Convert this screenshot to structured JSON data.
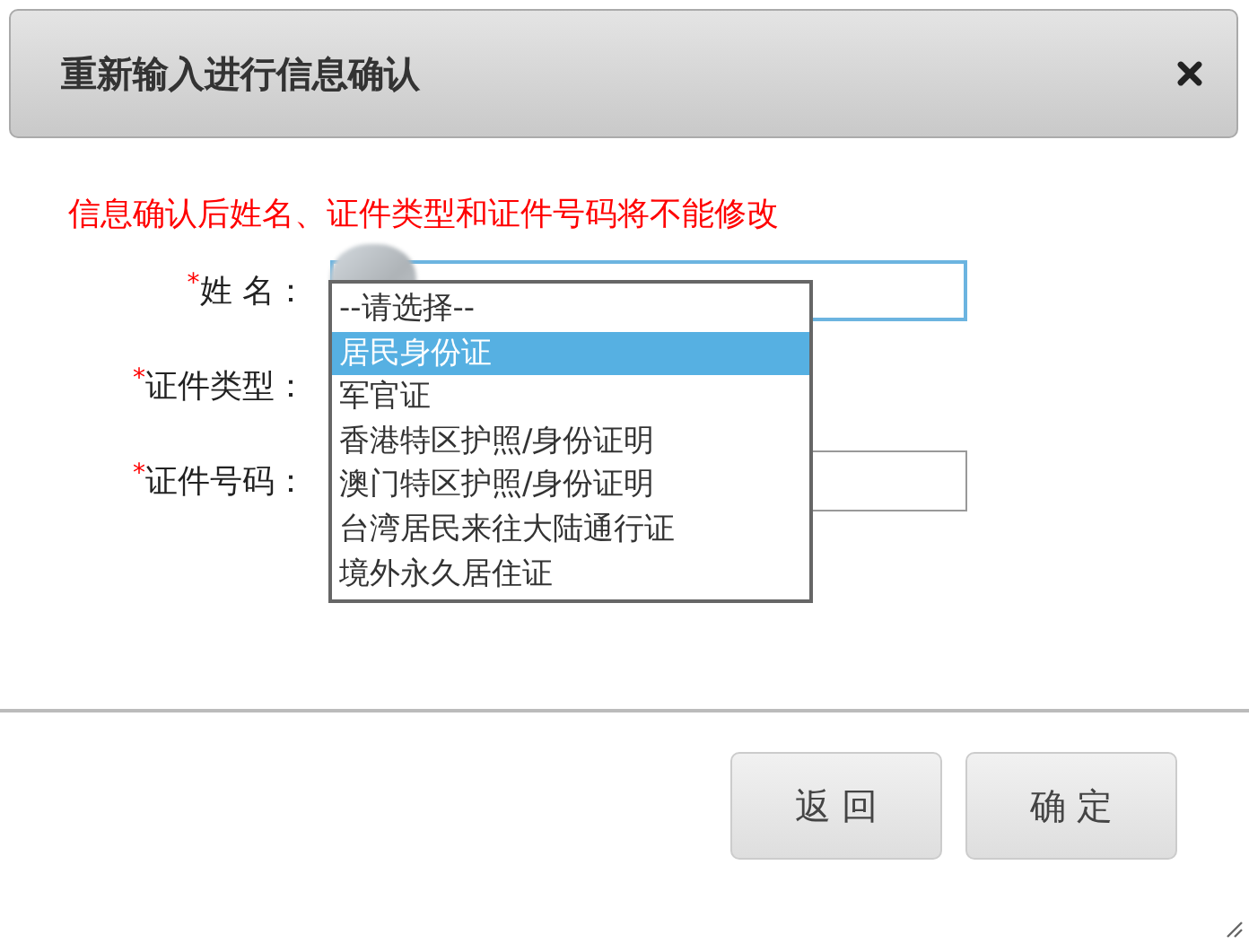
{
  "dialog": {
    "title": "重新输入进行信息确认"
  },
  "notice": "信息确认后姓名、证件类型和证件号码将不能修改",
  "fields": [
    {
      "kind": "text",
      "mark": "*",
      "label": "姓 名：",
      "focused": true,
      "redacted": true
    },
    {
      "kind": "select",
      "mark": "*",
      "label": "证件类型："
    },
    {
      "kind": "text",
      "mark": "*",
      "label": "证件号码：",
      "focused": false
    }
  ],
  "dropdown": {
    "options": [
      {
        "label": "--请选择--",
        "selected": false
      },
      {
        "label": "居民身份证",
        "selected": true
      },
      {
        "label": "军官证",
        "selected": false
      },
      {
        "label": "香港特区护照/身份证明",
        "selected": false
      },
      {
        "label": "澳门特区护照/身份证明",
        "selected": false
      },
      {
        "label": "台湾居民来往大陆通行证",
        "selected": false
      },
      {
        "label": "境外永久居住证",
        "selected": false
      }
    ]
  },
  "buttons": [
    {
      "label": "返 回"
    },
    {
      "label": "确 定"
    }
  ]
}
